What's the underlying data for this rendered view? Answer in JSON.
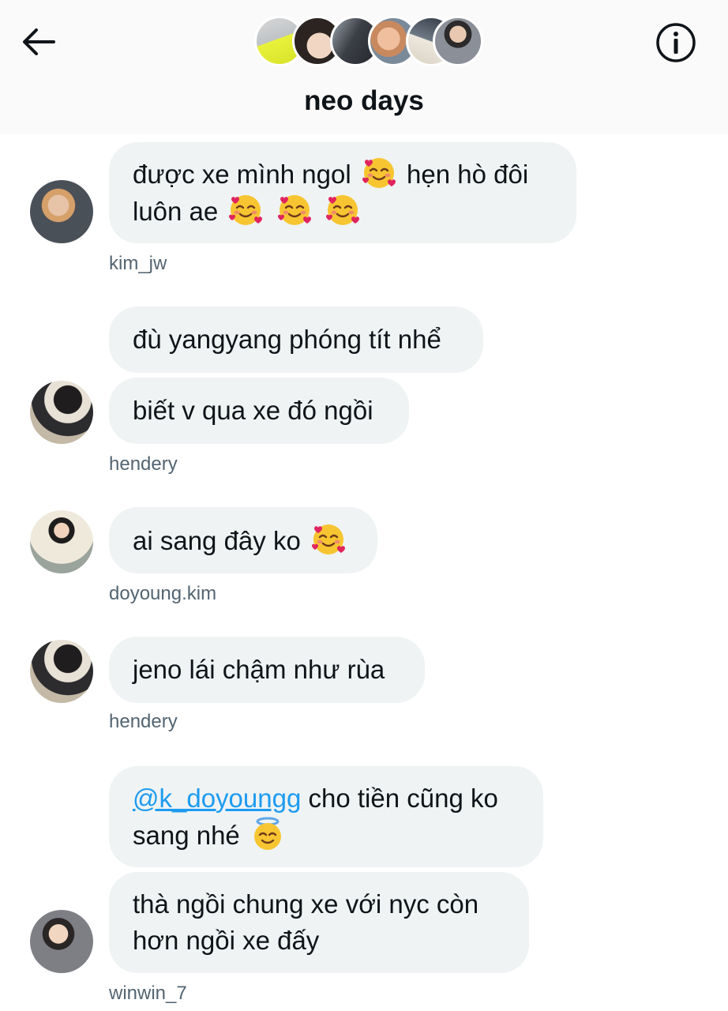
{
  "conversation": {
    "title": "neo days",
    "member_avatar_count": 6
  },
  "header": {
    "back_icon": "arrow-left-icon",
    "info_icon": "info-icon"
  },
  "colors": {
    "bubble_bg": "#eff3f4",
    "mention": "#1d9bf0",
    "username": "#536471",
    "text": "#0f1419"
  },
  "messages": [
    {
      "sender": "kim_jw",
      "segments": [
        {
          "line1_a": "được xe mình ngol",
          "emoji_1": "smiling-face-with-hearts",
          "line1_b": "hẹn hò đôi"
        },
        {
          "line2_a": "luôn ae",
          "emojis": [
            "smiling-face-with-hearts",
            "smiling-face-with-hearts",
            "smiling-face-with-hearts"
          ]
        }
      ]
    },
    {
      "sender": "hendery",
      "bubbles": [
        "đù yangyang phóng tít nhể",
        "biết v qua xe đó ngồi"
      ]
    },
    {
      "sender": "doyoung.kim",
      "text": "ai sang đây ko",
      "emoji": "smiling-face-with-hearts"
    },
    {
      "sender": "hendery",
      "text": "jeno lái chậm như rùa"
    },
    {
      "sender": "winwin_7",
      "bubble1": {
        "mention": "@k_doyoungg",
        "line1_rest": "cho tiền cũng ko",
        "line2": "sang nhé",
        "emoji": "smiling-face-with-halo"
      },
      "bubble2": {
        "line1": "thà ngồi chung xe với nyc còn",
        "line2": "hơn ngồi xe đấy"
      }
    }
  ]
}
